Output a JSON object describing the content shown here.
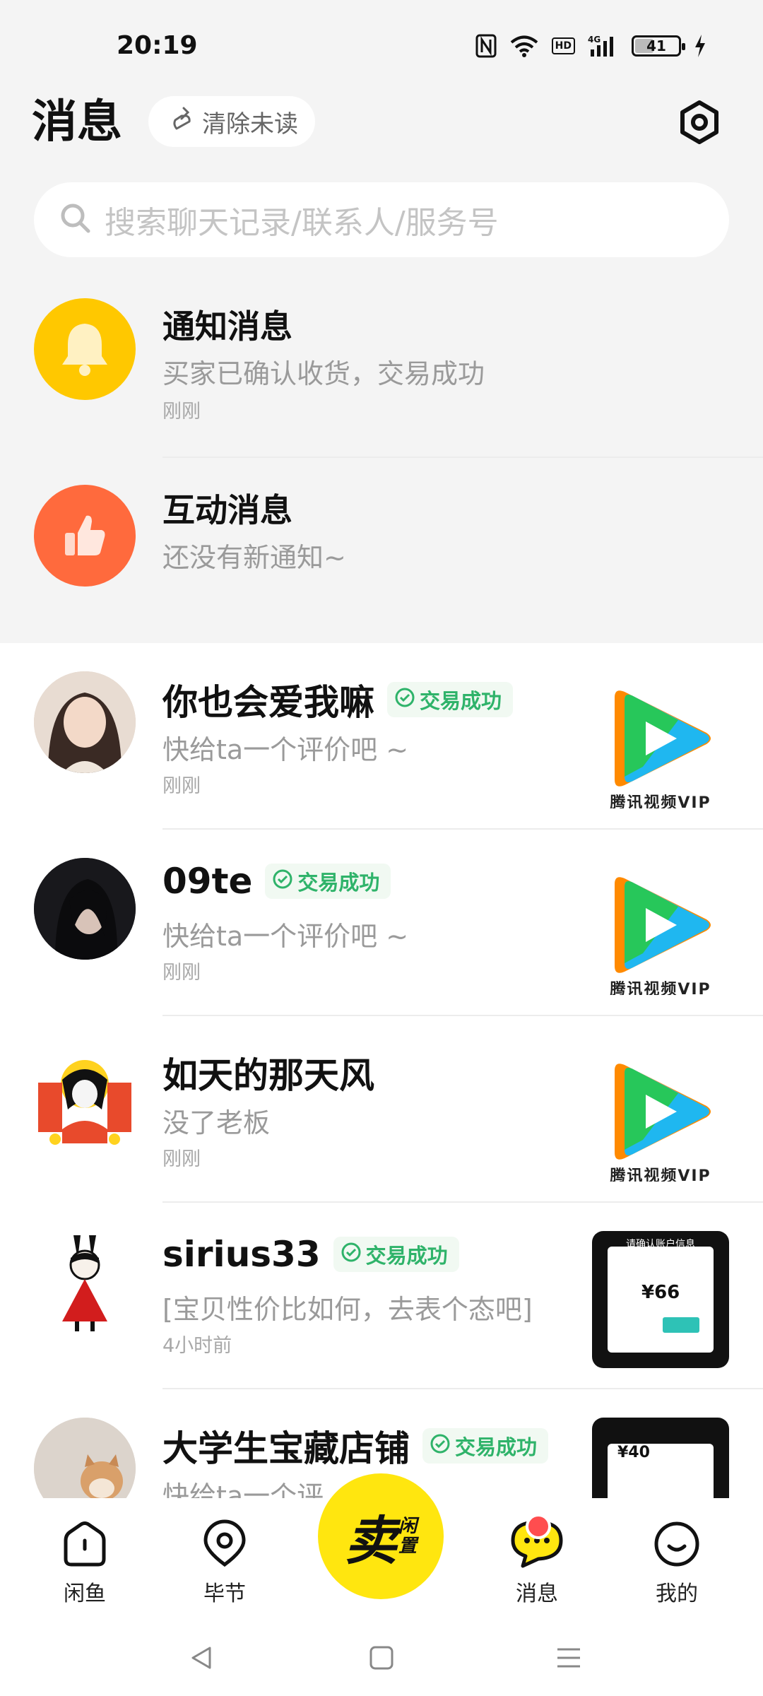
{
  "status_bar": {
    "time": "20:19",
    "hd": "HD",
    "network": "4G",
    "battery": "41"
  },
  "header": {
    "title": "消息",
    "clear_unread": "清除未读"
  },
  "search": {
    "placeholder": "搜索聊天记录/联系人/服务号"
  },
  "system_messages": [
    {
      "title": "通知消息",
      "subtitle": "买家已确认收货，交易成功",
      "time": "刚刚",
      "icon": "bell-icon",
      "color": "#ffc800"
    },
    {
      "title": "互动消息",
      "subtitle": "还没有新通知~",
      "time": "",
      "icon": "thumbs-up-icon",
      "color": "#ff6a3d"
    }
  ],
  "chats": [
    {
      "name": "你也会爱我嘛",
      "badge": "交易成功",
      "message": "快给ta一个评价吧 ~",
      "time": "刚刚",
      "thumb": "video-vip",
      "thumb_caption": "腾讯视频VIP"
    },
    {
      "name": "09te",
      "badge": "交易成功",
      "message": "快给ta一个评价吧 ~",
      "time": "刚刚",
      "thumb": "video-vip",
      "thumb_caption": "腾讯视频VIP"
    },
    {
      "name": "如天的那天风",
      "badge": "",
      "message": "没了老板",
      "time": "刚刚",
      "thumb": "video-vip",
      "thumb_caption": "腾讯视频VIP"
    },
    {
      "name": "sirius33",
      "badge": "交易成功",
      "message": "[宝贝性价比如何，去表个态吧]",
      "time": "4小时前",
      "thumb": "receipt",
      "thumb_title": "请确认账户信息",
      "thumb_price": "¥66"
    },
    {
      "name": "大学生宝藏店铺",
      "badge": "交易成功",
      "message": "快给ta一个评",
      "time": "",
      "thumb": "receipt",
      "thumb_title": "",
      "thumb_price": "¥40"
    }
  ],
  "bottom_nav": {
    "home": "闲鱼",
    "nearby": "毕节",
    "sell_big": "卖",
    "sell_small_1": "闲",
    "sell_small_2": "置",
    "messages": "消息",
    "mine": "我的"
  },
  "colors": {
    "accent_yellow": "#ffe60f",
    "success_green": "#2fb36a",
    "notify_red": "#ff4d4f"
  }
}
